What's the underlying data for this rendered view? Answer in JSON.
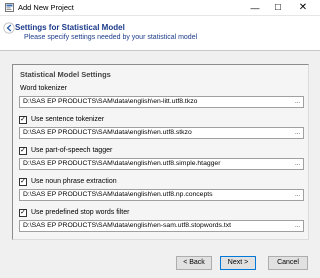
{
  "window": {
    "title": "Add New Project",
    "minimize_glyph": "—",
    "maximize_glyph": "☐",
    "close_glyph": "✕"
  },
  "header": {
    "title": "Settings for Statistical Model",
    "subtitle": "Please specify settings needed by your statistical model"
  },
  "panel": {
    "title": "Statistical Model Settings",
    "word_tokenizer": {
      "label": "Word tokenizer",
      "value": "D:\\SAS EP PRODUCTS\\SAM\\data\\english\\en-litt.utf8.tkzo"
    },
    "sentence_tokenizer": {
      "label": "Use sentence tokenizer",
      "checked": true,
      "value": "D:\\SAS EP PRODUCTS\\SAM\\data\\english\\en.utf8.stkzo"
    },
    "pos_tagger": {
      "label": "Use part-of-speech tagger",
      "checked": true,
      "value": "D:\\SAS EP PRODUCTS\\SAM\\data\\english\\en.utf8.simple.htagger"
    },
    "noun_phrase": {
      "label": "Use noun phrase extraction",
      "checked": true,
      "value": "D:\\SAS EP PRODUCTS\\SAM\\data\\english\\en.utf8.np.concepts"
    },
    "stop_words": {
      "label": "Use predefined stop words filter",
      "checked": true,
      "value": "D:\\SAS EP PRODUCTS\\SAM\\data\\english\\en-sam.utf8.stopwords.txt"
    },
    "browse_glyph": "..."
  },
  "footer": {
    "back_label": "< Back",
    "next_label": "Next >",
    "cancel_label": "Cancel"
  },
  "colors": {
    "header_text": "#1b3a8a",
    "default_button_border": "#0078d7"
  },
  "icons": {
    "app": "app-icon",
    "back": "back-arrow-icon",
    "checkbox": "checkmark-icon"
  }
}
